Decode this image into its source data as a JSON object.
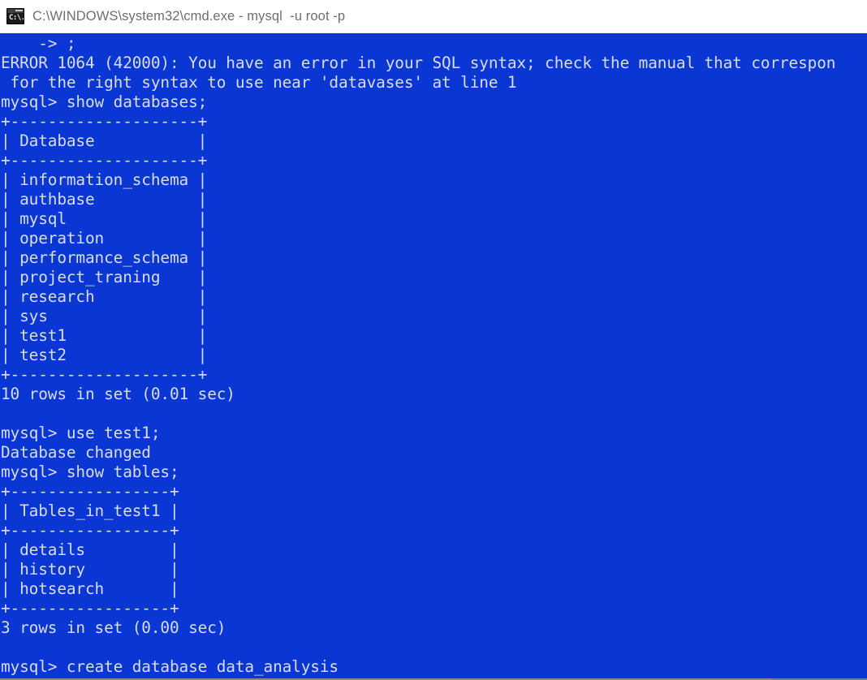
{
  "window": {
    "title": "C:\\WINDOWS\\system32\\cmd.exe - mysql  -u root -p",
    "icon": "cmd-console-icon",
    "icon_glyph": "C:\\.",
    "titlebar_bg": "#ffffff",
    "titlebar_text_color": "#6e6e6e"
  },
  "console": {
    "background": "#0a37d4",
    "foreground": "#d8dde8",
    "lines": [
      "    -> ;",
      "ERROR 1064 (42000): You have an error in your SQL syntax; check the manual that correspon",
      " for the right syntax to use near 'datavases' at line 1",
      "mysql> show databases;",
      "+--------------------+",
      "| Database           |",
      "+--------------------+",
      "| information_schema |",
      "| authbase           |",
      "| mysql              |",
      "| operation          |",
      "| performance_schema |",
      "| project_traning    |",
      "| research           |",
      "| sys                |",
      "| test1              |",
      "| test2              |",
      "+--------------------+",
      "10 rows in set (0.01 sec)",
      "",
      "mysql> use test1;",
      "Database changed",
      "mysql> show tables;",
      "+-----------------+",
      "| Tables_in_test1 |",
      "+-----------------+",
      "| details         |",
      "| history         |",
      "| hotsearch       |",
      "+-----------------+",
      "3 rows in set (0.00 sec)",
      "",
      "mysql> create database data_analysis"
    ],
    "prompt": "mysql>",
    "continuation_prompt": "->",
    "error": {
      "code": "ERROR 1064 (42000)",
      "message": "You have an error in your SQL syntax; check the manual that correspon for the right syntax to use near 'datavases' at line 1",
      "near_token": "datavases",
      "line": "1"
    },
    "databases_result": {
      "header": "Database",
      "rows": [
        "information_schema",
        "authbase",
        "mysql",
        "operation",
        "performance_schema",
        "project_traning",
        "research",
        "sys",
        "test1",
        "test2"
      ],
      "status": "10 rows in set (0.01 sec)"
    },
    "tables_result": {
      "header": "Tables_in_test1",
      "rows": [
        "details",
        "history",
        "hotsearch"
      ],
      "status": "3 rows in set (0.00 sec)"
    },
    "commands": [
      "show databases;",
      "use test1;",
      "show tables;",
      "create database data_analysis"
    ],
    "messages": [
      "Database changed"
    ]
  }
}
